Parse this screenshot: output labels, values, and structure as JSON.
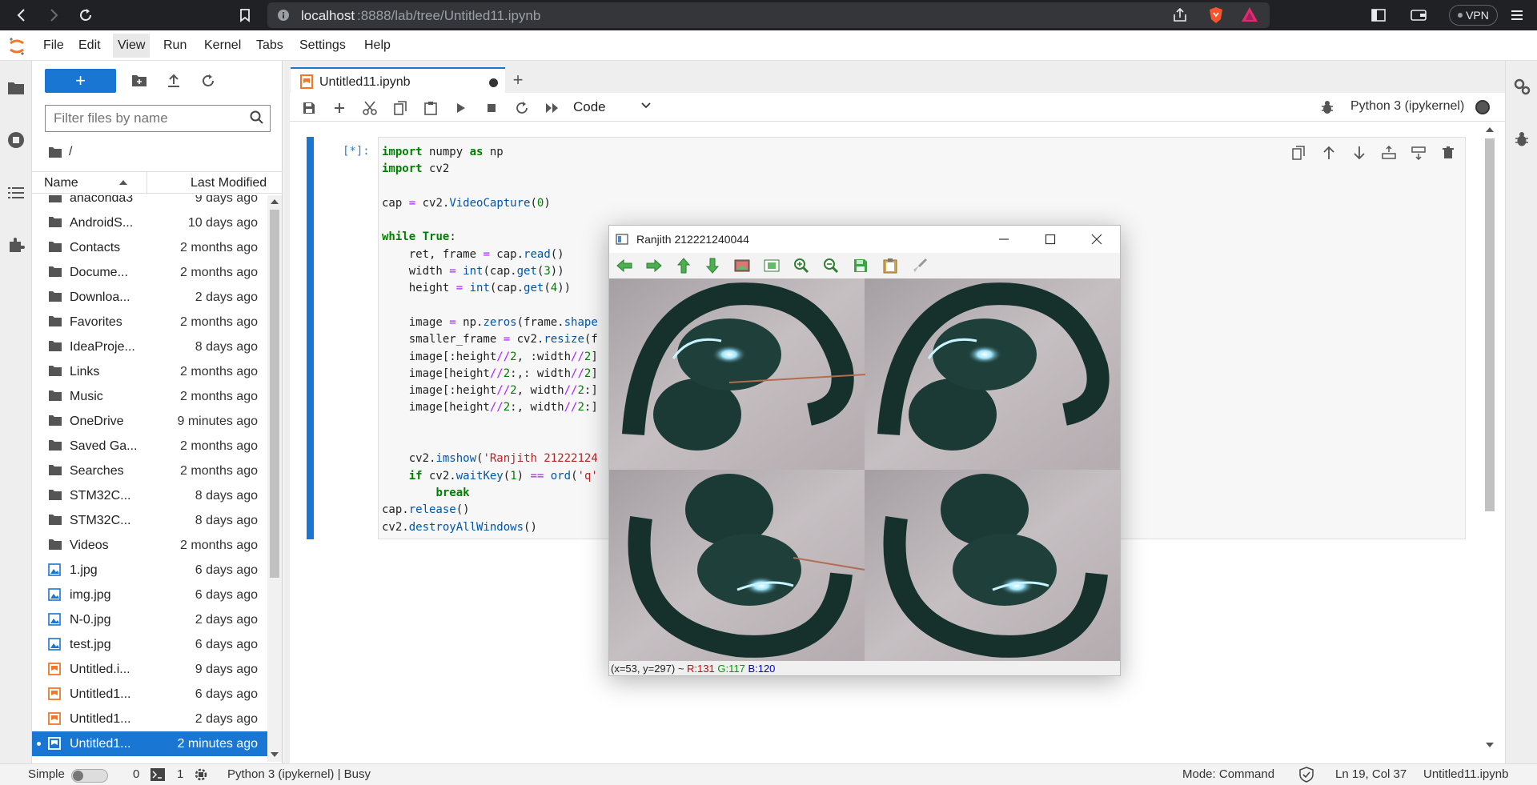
{
  "browser": {
    "url_host": "localhost",
    "url_rest": ":8888/lab/tree/Untitled11.ipynb",
    "vpn_label": "VPN"
  },
  "menubar": {
    "items": [
      "File",
      "Edit",
      "View",
      "Run",
      "Kernel",
      "Tabs",
      "Settings",
      "Help"
    ]
  },
  "filebrowser": {
    "new_label": "+",
    "filter_placeholder": "Filter files by name",
    "crumb": "/",
    "col_name": "Name",
    "col_modified": "Last Modified",
    "files": [
      {
        "name": "anaconda3",
        "modified": "9 days ago",
        "type": "folder"
      },
      {
        "name": "AndroidS...",
        "modified": "10 days ago",
        "type": "folder"
      },
      {
        "name": "Contacts",
        "modified": "2 months ago",
        "type": "folder"
      },
      {
        "name": "Docume...",
        "modified": "2 months ago",
        "type": "folder"
      },
      {
        "name": "Downloa...",
        "modified": "2 days ago",
        "type": "folder"
      },
      {
        "name": "Favorites",
        "modified": "2 months ago",
        "type": "folder"
      },
      {
        "name": "IdeaProje...",
        "modified": "8 days ago",
        "type": "folder"
      },
      {
        "name": "Links",
        "modified": "2 months ago",
        "type": "folder"
      },
      {
        "name": "Music",
        "modified": "2 months ago",
        "type": "folder"
      },
      {
        "name": "OneDrive",
        "modified": "9 minutes ago",
        "type": "folder"
      },
      {
        "name": "Saved Ga...",
        "modified": "2 months ago",
        "type": "folder"
      },
      {
        "name": "Searches",
        "modified": "2 months ago",
        "type": "folder"
      },
      {
        "name": "STM32C...",
        "modified": "8 days ago",
        "type": "folder"
      },
      {
        "name": "STM32C...",
        "modified": "8 days ago",
        "type": "folder"
      },
      {
        "name": "Videos",
        "modified": "2 months ago",
        "type": "folder"
      },
      {
        "name": "1.jpg",
        "modified": "6 days ago",
        "type": "image"
      },
      {
        "name": "img.jpg",
        "modified": "6 days ago",
        "type": "image"
      },
      {
        "name": "N-0.jpg",
        "modified": "2 days ago",
        "type": "image"
      },
      {
        "name": "test.jpg",
        "modified": "6 days ago",
        "type": "image"
      },
      {
        "name": "Untitled.i...",
        "modified": "9 days ago",
        "type": "notebook"
      },
      {
        "name": "Untitled1...",
        "modified": "6 days ago",
        "type": "notebook"
      },
      {
        "name": "Untitled1...",
        "modified": "2 days ago",
        "type": "notebook"
      },
      {
        "name": "Untitled1...",
        "modified": "2 minutes ago",
        "type": "notebook",
        "selected": true
      }
    ]
  },
  "notebook": {
    "tab_label": "Untitled11.ipynb",
    "cell_type": "Code",
    "kernel": "Python 3 (ipykernel)",
    "prompt": "[*]:",
    "code_lines": [
      "import numpy as np",
      "import cv2",
      "",
      "cap = cv2.VideoCapture(0)",
      "",
      "while True:",
      "    ret, frame = cap.read()",
      "    width = int(cap.get(3))",
      "    height = int(cap.get(4))",
      "",
      "    image = np.zeros(frame.shape",
      "    smaller_frame = cv2.resize(f",
      "    image[:height//2, :width//2]",
      "    image[height//2:,: width//2]",
      "    image[:height//2, width//2:]",
      "    image[height//2:, width//2:]",
      "",
      "",
      "    cv2.imshow('Ranjith 21222124",
      "    if cv2.waitKey(1) == ord('q'",
      "        break",
      "cap.release()",
      "cv2.destroyAllWindows()"
    ]
  },
  "cvwindow": {
    "title": "Ranjith 212221240044",
    "status_xy": "(x=53, y=297) ~ ",
    "status_r": "R:131",
    "status_g": "G:117",
    "status_b": "B:120"
  },
  "statusbar": {
    "simple": "Simple",
    "count0": "0",
    "count1": "1",
    "kernel_status": "Python 3 (ipykernel) | Busy",
    "mode": "Mode: Command",
    "position": "Ln 19, Col 37",
    "filename": "Untitled11.ipynb"
  },
  "colors": {
    "accent": "#1976d2",
    "chrome": "#202124"
  }
}
